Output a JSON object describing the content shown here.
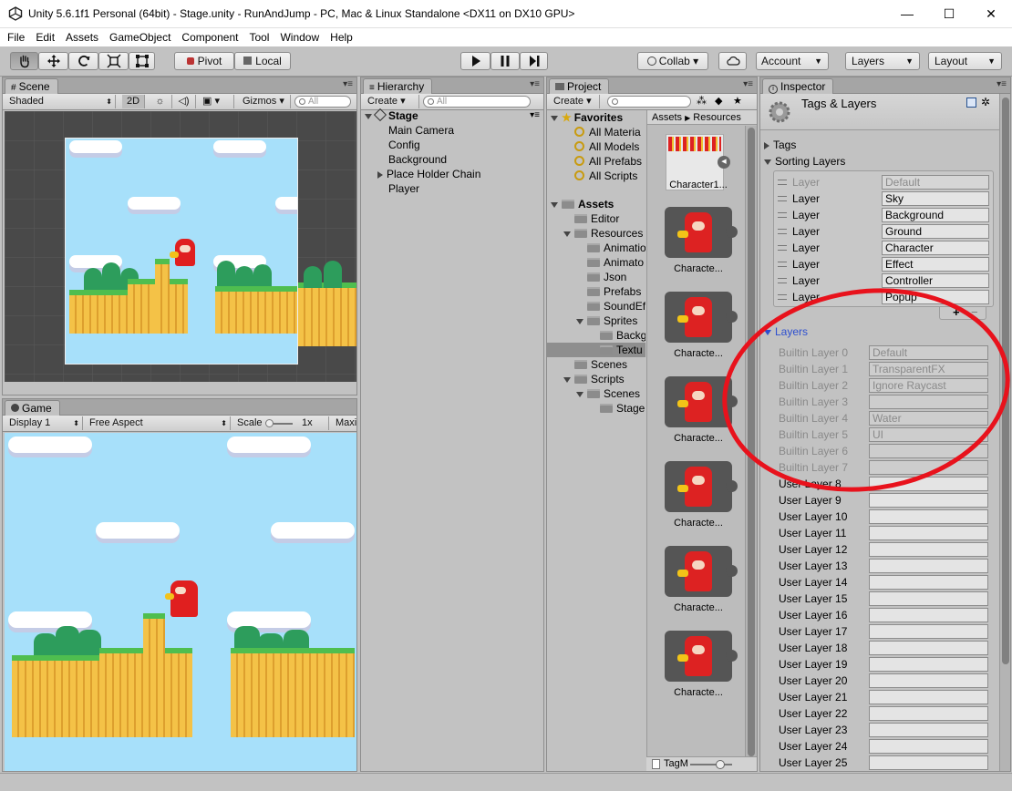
{
  "window": {
    "title": "Unity 5.6.1f1 Personal (64bit) - Stage.unity - RunAndJump - PC, Mac & Linux Standalone <DX11 on DX10 GPU>",
    "minimize": "—",
    "maximize": "☐",
    "close": "✕"
  },
  "menu": [
    "File",
    "Edit",
    "Assets",
    "GameObject",
    "Component",
    "Tool",
    "Window",
    "Help"
  ],
  "toolbar": {
    "pivot": "Pivot",
    "local": "Local",
    "collab": "Collab ▾",
    "account": "Account",
    "layers": "Layers",
    "layout": "Layout"
  },
  "scene": {
    "tab": "Scene",
    "shading": "Shaded",
    "mode2d": "2D",
    "gizmos": "Gizmos",
    "search_placeholder": "All"
  },
  "game": {
    "tab": "Game",
    "display": "Display 1",
    "aspect": "Free Aspect",
    "scale_label": "Scale",
    "scale_value": "1x",
    "maximize": "Maxi"
  },
  "hierarchy": {
    "tab": "Hierarchy",
    "create": "Create",
    "search_placeholder": "All",
    "root": "Stage",
    "items": [
      "Main Camera",
      "Config",
      "Background",
      "Place Holder Chain",
      "Player"
    ]
  },
  "project": {
    "tab": "Project",
    "create": "Create",
    "favorites": "Favorites",
    "fav_items": [
      "All Materia",
      "All Models",
      "All Prefabs",
      "All Scripts"
    ],
    "assets": "Assets",
    "tree": [
      {
        "label": "Editor",
        "indent": 1,
        "arrow": "none"
      },
      {
        "label": "Resources",
        "indent": 1,
        "arrow": "down"
      },
      {
        "label": "Animatio",
        "indent": 2,
        "arrow": "none"
      },
      {
        "label": "Animato",
        "indent": 2,
        "arrow": "none"
      },
      {
        "label": "Json",
        "indent": 2,
        "arrow": "none"
      },
      {
        "label": "Prefabs",
        "indent": 2,
        "arrow": "none"
      },
      {
        "label": "SoundEf",
        "indent": 2,
        "arrow": "none"
      },
      {
        "label": "Sprites",
        "indent": 2,
        "arrow": "down"
      },
      {
        "label": "Backg",
        "indent": 3,
        "arrow": "none"
      },
      {
        "label": "Textu",
        "indent": 3,
        "arrow": "none"
      },
      {
        "label": "Scenes",
        "indent": 1,
        "arrow": "none"
      },
      {
        "label": "Scripts",
        "indent": 1,
        "arrow": "down"
      },
      {
        "label": "Scenes",
        "indent": 2,
        "arrow": "down"
      },
      {
        "label": "Stage",
        "indent": 3,
        "arrow": "none"
      }
    ],
    "breadcrumb": [
      "Assets",
      "Resources"
    ],
    "thumbs": [
      "Character1...",
      "Characte...",
      "Characte...",
      "Characte...",
      "Characte...",
      "Characte...",
      "Characte..."
    ],
    "footer_label": "TagM"
  },
  "inspector": {
    "tab": "Inspector",
    "title": "Tags & Layers",
    "tags_header": "Tags",
    "sorting_header": "Sorting Layers",
    "sorting_label": "Layer",
    "sorting_layers": [
      "Default",
      "Sky",
      "Background",
      "Ground",
      "Character",
      "Effect",
      "Controller",
      "Popup"
    ],
    "add": "+",
    "remove": "−",
    "layers_header": "Layers",
    "layers": [
      {
        "label": "Builtin Layer 0",
        "value": "Default",
        "builtin": true
      },
      {
        "label": "Builtin Layer 1",
        "value": "TransparentFX",
        "builtin": true
      },
      {
        "label": "Builtin Layer 2",
        "value": "Ignore Raycast",
        "builtin": true
      },
      {
        "label": "Builtin Layer 3",
        "value": "",
        "builtin": true
      },
      {
        "label": "Builtin Layer 4",
        "value": "Water",
        "builtin": true
      },
      {
        "label": "Builtin Layer 5",
        "value": "UI",
        "builtin": true
      },
      {
        "label": "Builtin Layer 6",
        "value": "",
        "builtin": true
      },
      {
        "label": "Builtin Layer 7",
        "value": "",
        "builtin": true
      },
      {
        "label": "User Layer 8",
        "value": "",
        "builtin": false
      },
      {
        "label": "User Layer 9",
        "value": "",
        "builtin": false
      },
      {
        "label": "User Layer 10",
        "value": "",
        "builtin": false
      },
      {
        "label": "User Layer 11",
        "value": "",
        "builtin": false
      },
      {
        "label": "User Layer 12",
        "value": "",
        "builtin": false
      },
      {
        "label": "User Layer 13",
        "value": "",
        "builtin": false
      },
      {
        "label": "User Layer 14",
        "value": "",
        "builtin": false
      },
      {
        "label": "User Layer 15",
        "value": "",
        "builtin": false
      },
      {
        "label": "User Layer 16",
        "value": "",
        "builtin": false
      },
      {
        "label": "User Layer 17",
        "value": "",
        "builtin": false
      },
      {
        "label": "User Layer 18",
        "value": "",
        "builtin": false
      },
      {
        "label": "User Layer 19",
        "value": "",
        "builtin": false
      },
      {
        "label": "User Layer 20",
        "value": "",
        "builtin": false
      },
      {
        "label": "User Layer 21",
        "value": "",
        "builtin": false
      },
      {
        "label": "User Layer 22",
        "value": "",
        "builtin": false
      },
      {
        "label": "User Layer 23",
        "value": "",
        "builtin": false
      },
      {
        "label": "User Layer 24",
        "value": "",
        "builtin": false
      },
      {
        "label": "User Layer 25",
        "value": "",
        "builtin": false
      }
    ]
  },
  "colors": {
    "annotation": "#e8121c",
    "sky": "#a7e0fa",
    "link": "#2d4fcf"
  }
}
